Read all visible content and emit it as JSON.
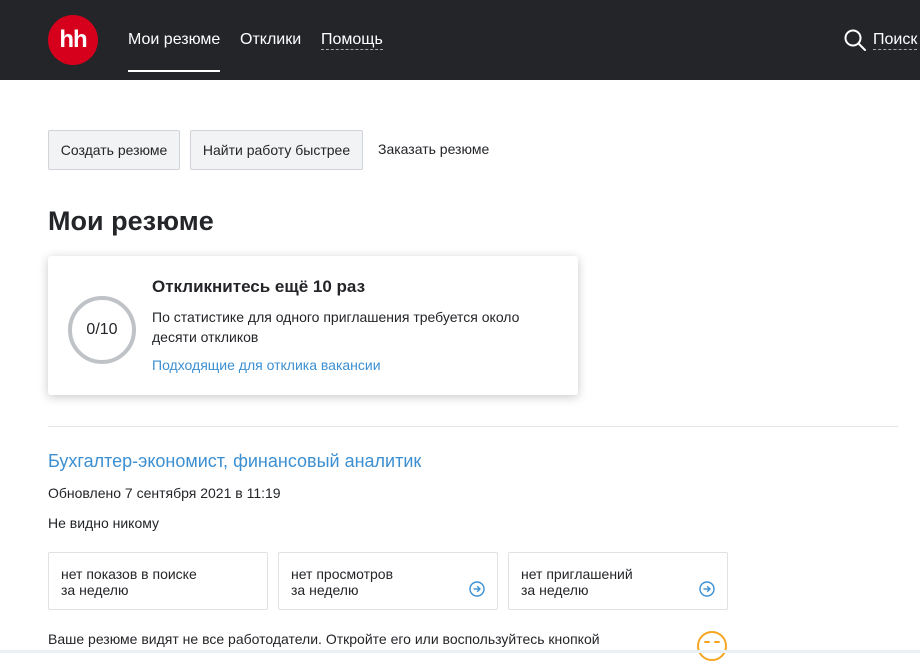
{
  "header": {
    "logo_text": "hh",
    "nav": {
      "my_resumes": "Мои резюме",
      "responses": "Отклики",
      "help": "Помощь"
    },
    "search_label": "Поиск",
    "search_icon": "search-icon"
  },
  "actions": {
    "create_resume": "Создать резюме",
    "find_job_faster": "Найти работу быстрее",
    "order_resume": "Заказать резюме"
  },
  "page_title": "Мои резюме",
  "response_card": {
    "progress_text": "0/10",
    "progress_value": 0,
    "progress_total": 10,
    "title": "Откликнитесь ещё 10 раз",
    "text": "По статистике для одного приглашения требуется около десяти откликов",
    "link": "Подходящие для отклика вакансии"
  },
  "resume": {
    "title": "Бухгалтер-экономист, финансовый аналитик",
    "updated": "Обновлено 7 сентября 2021 в 11:19",
    "visibility": "Не видно никому",
    "stats": [
      {
        "line1": "нет показов в поиске",
        "line2": "за неделю"
      },
      {
        "line1": "нет просмотров",
        "line2": "за неделю",
        "icon": "arrow-circle-icon"
      },
      {
        "line1": "нет приглашений",
        "line2": "за неделю",
        "icon": "arrow-circle-icon"
      }
    ],
    "visibility_hint": "Ваше резюме видят не все работодатели. Откройте его или воспользуйтесь кнопкой"
  },
  "colors": {
    "header_bg": "#232529",
    "brand_red": "#d6001c",
    "link_blue": "#3c8fd1",
    "emoji_orange": "#f5a623"
  }
}
